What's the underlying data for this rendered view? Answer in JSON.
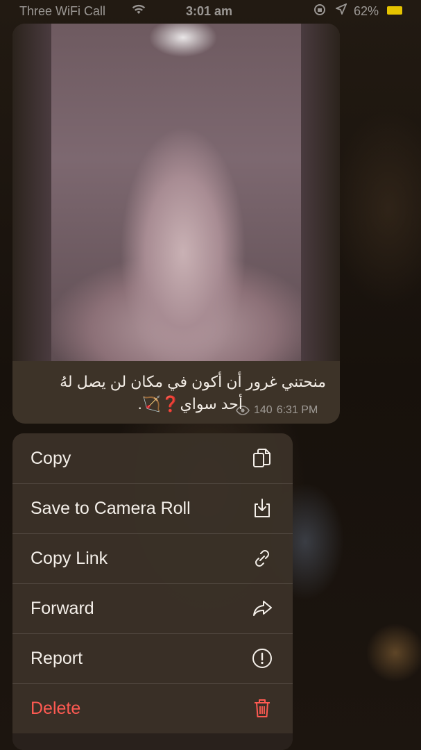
{
  "status_bar": {
    "carrier": "Three WiFi Call",
    "time": "3:01 am",
    "battery_percent": "62%",
    "icons": [
      "signal-icon",
      "wifi-icon",
      "orientation-lock-icon",
      "location-icon",
      "battery-icon"
    ]
  },
  "message": {
    "caption_line1": "منحتني غرور أن أكون في مكان لن يصل لهُ",
    "caption_line2": "أحد سواي❓🏹.",
    "views": "140",
    "time": "6:31 PM"
  },
  "context_menu": {
    "items": [
      {
        "label": "Copy",
        "icon": "copy-icon"
      },
      {
        "label": "Save to Camera Roll",
        "icon": "download-icon"
      },
      {
        "label": "Copy Link",
        "icon": "link-icon"
      },
      {
        "label": "Forward",
        "icon": "forward-icon"
      },
      {
        "label": "Report",
        "icon": "report-icon"
      },
      {
        "label": "Delete",
        "icon": "trash-icon"
      }
    ],
    "destructive_color": "#ff5a52"
  }
}
